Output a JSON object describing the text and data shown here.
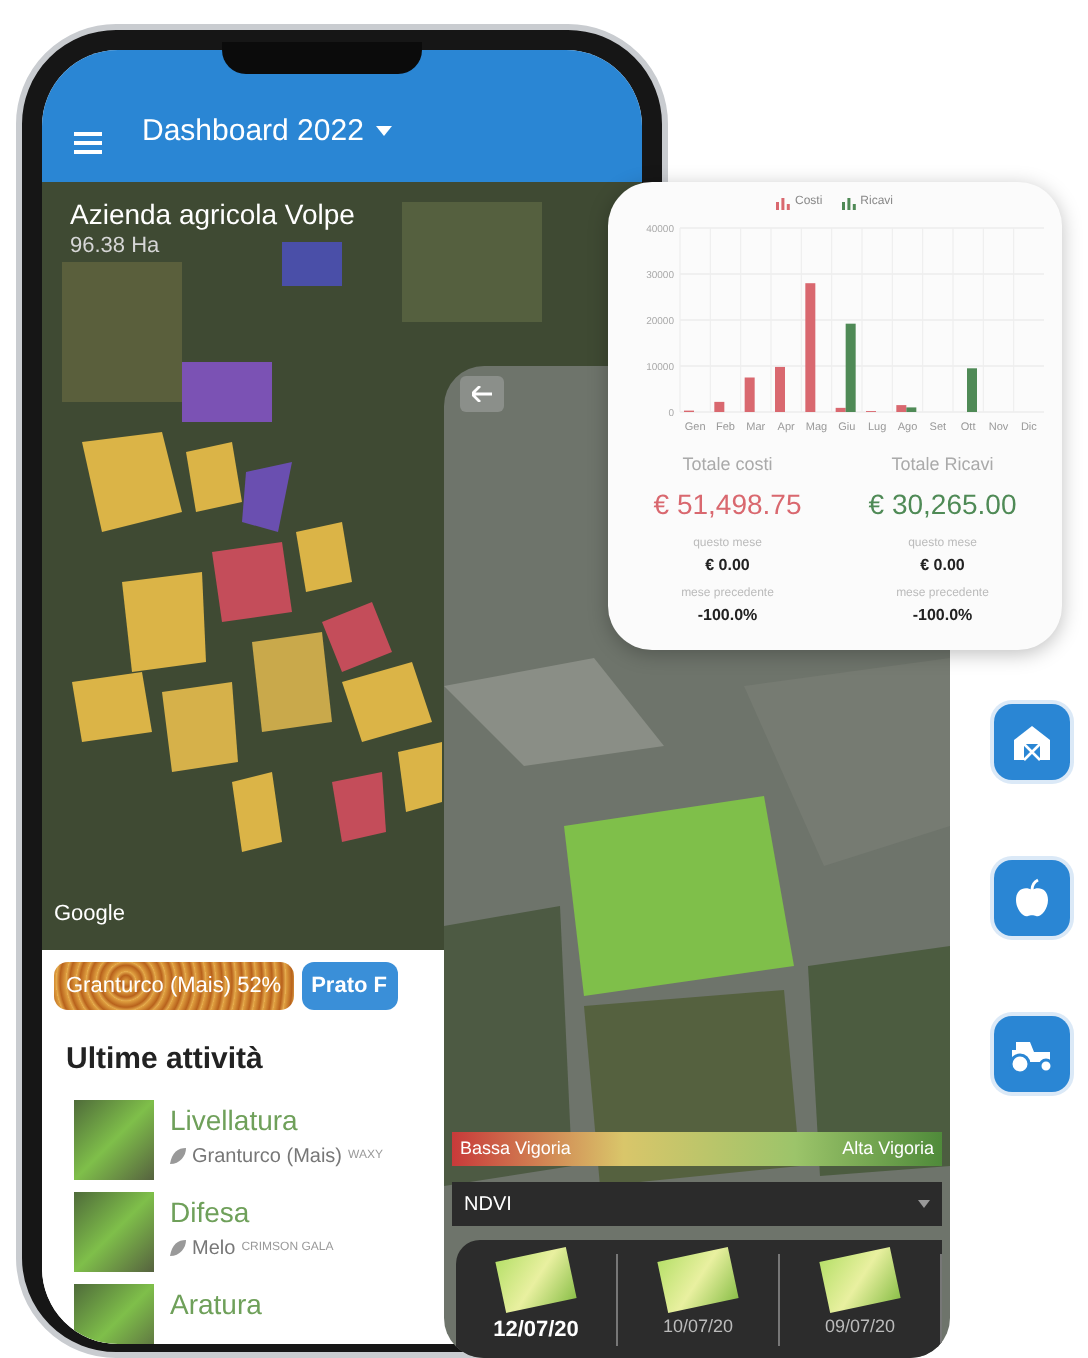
{
  "phone": {
    "menu_title": "Dashboard 2022",
    "farm_name": "Azienda agricola Volpe",
    "farm_area": "96.38 Ha",
    "map_attribution": "Google",
    "crop_chips": [
      {
        "label": "Granturco (Mais) 52%",
        "kind": "texture"
      },
      {
        "label": "Prato F",
        "kind": "solid"
      }
    ],
    "activities_title": "Ultime attività",
    "activities": [
      {
        "title": "Livellatura",
        "crop": "Granturco (Mais)",
        "variety": "WAXY"
      },
      {
        "title": "Difesa",
        "crop": "Melo",
        "variety": "CRIMSON GALA"
      },
      {
        "title": "Aratura"
      }
    ]
  },
  "ndvi_panel": {
    "legend_low": "Bassa Vigoria",
    "legend_high": "Alta Vigoria",
    "index_select": "NDVI",
    "dates": [
      {
        "label": "12/07/20",
        "selected": true
      },
      {
        "label": "10/07/20",
        "selected": false
      },
      {
        "label": "09/07/20",
        "selected": false
      }
    ]
  },
  "finance_card": {
    "chart_data": {
      "type": "bar",
      "categories": [
        "Gen",
        "Feb",
        "Mar",
        "Apr",
        "Mag",
        "Giu",
        "Lug",
        "Ago",
        "Set",
        "Ott",
        "Nov",
        "Dic"
      ],
      "series": [
        {
          "name": "Costi",
          "color": "#d9686f",
          "values": [
            300,
            2200,
            7500,
            9800,
            28000,
            900,
            200,
            1500,
            0,
            0,
            0,
            0
          ]
        },
        {
          "name": "Ricavi",
          "color": "#4f8a56",
          "values": [
            0,
            0,
            0,
            0,
            0,
            19200,
            0,
            1000,
            0,
            9500,
            0,
            0
          ]
        }
      ],
      "ylim": [
        0,
        40000
      ],
      "grid": true,
      "yticks": [
        0,
        10000,
        20000,
        30000,
        40000
      ]
    },
    "totals": [
      {
        "kind": "cost",
        "label": "Totale costi",
        "amount": "€ 51,498.75",
        "month_label": "questo mese",
        "month_value": "€ 0.00",
        "prev_label": "mese precedente",
        "prev_value": "-100.0%"
      },
      {
        "kind": "revenue",
        "label": "Totale Ricavi",
        "amount": "€ 30,265.00",
        "month_label": "questo mese",
        "month_value": "€ 0.00",
        "prev_label": "mese precedente",
        "prev_value": "-100.0%"
      }
    ]
  }
}
